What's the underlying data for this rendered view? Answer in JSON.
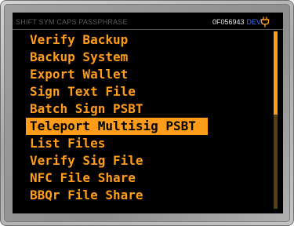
{
  "status": {
    "modes": "SHIFT SYM CAPS  PASSPHRASE",
    "fingerprint": "0F056943",
    "dev_badge": "DEV",
    "power_icon": "plug-icon"
  },
  "menu": {
    "items": [
      {
        "label": "Verify Backup"
      },
      {
        "label": "Backup System"
      },
      {
        "label": "Export Wallet"
      },
      {
        "label": "Sign Text File"
      },
      {
        "label": "Batch Sign PSBT"
      },
      {
        "label": "Teleport Multisig PSBT",
        "selected": true
      },
      {
        "label": "List Files"
      },
      {
        "label": "Verify Sig File"
      },
      {
        "label": "NFC File Share"
      },
      {
        "label": "BBQr File Share"
      }
    ],
    "selected_index": 5
  },
  "scrollbar": {
    "position_fraction": 0.0,
    "visible_fraction": 0.47
  },
  "colors": {
    "accent": "#ff9d1a",
    "screen_bg": "#000000",
    "dev_badge": "#3b6bff",
    "status_text": "#5a5a5a"
  }
}
